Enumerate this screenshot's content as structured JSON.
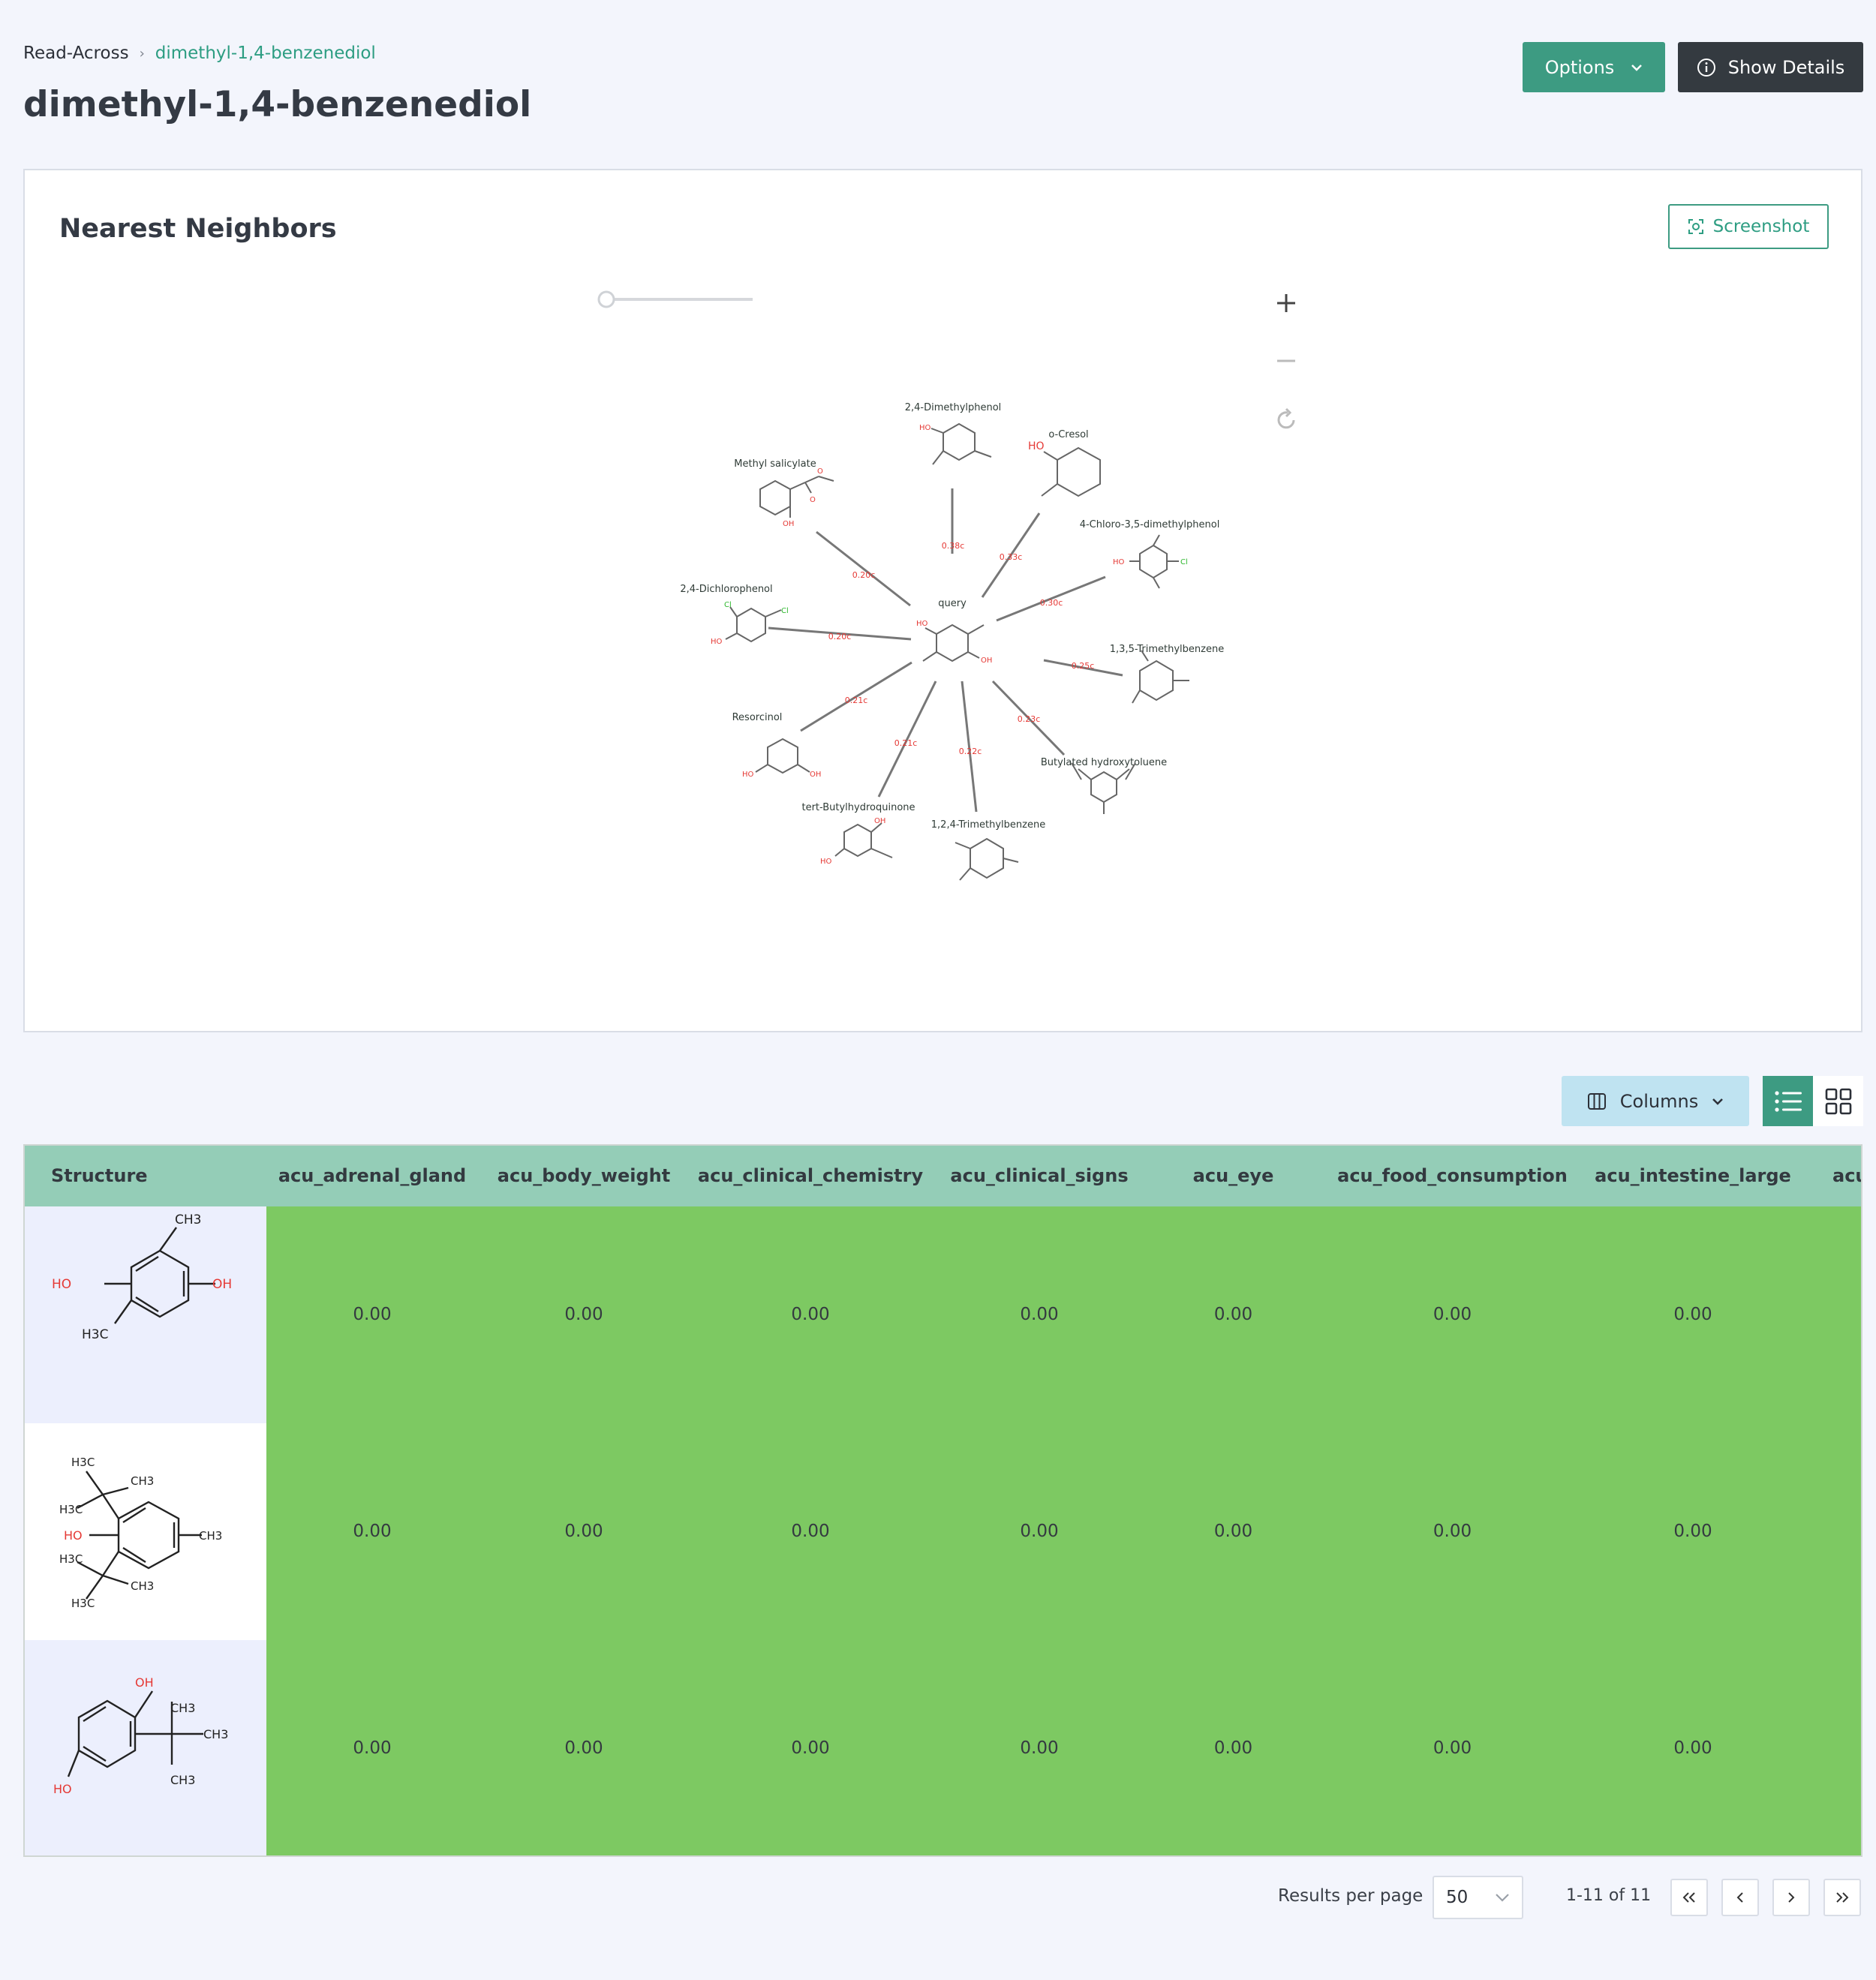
{
  "breadcrumb": {
    "root": "Read-Across",
    "current": "dimethyl-1,4-benzenediol"
  },
  "page": {
    "title": "dimethyl-1,4-benzenediol"
  },
  "header": {
    "options_label": "Options",
    "details_label": "Show Details"
  },
  "nearest_neighbors": {
    "title": "Nearest Neighbors",
    "screenshot_label": "Screenshot",
    "controls": [
      "zoom-in-icon",
      "zoom-out-icon",
      "reset-icon"
    ],
    "query_label": "query",
    "neighbors": [
      {
        "name": "2,4-Dimethylphenol",
        "distance": "0.38c"
      },
      {
        "name": "o-Cresol",
        "distance": "0.33c"
      },
      {
        "name": "4-Chloro-3,5-dimethylphenol",
        "distance": "0.30c"
      },
      {
        "name": "1,3,5-Trimethylbenzene",
        "distance": "0.25c"
      },
      {
        "name": "Butylated hydroxytoluene",
        "distance": "0.23c"
      },
      {
        "name": "1,2,4-Trimethylbenzene",
        "distance": "0.22c"
      },
      {
        "name": "tert-Butylhydroquinone",
        "distance": "0.21c"
      },
      {
        "name": "Resorcinol",
        "distance": "0.21c"
      },
      {
        "name": "2,4-Dichlorophenol",
        "distance": "0.20c"
      },
      {
        "name": "Methyl salicylate",
        "distance": "0.20c"
      }
    ],
    "atom_labels": {
      "HO": "HO",
      "OH": "OH",
      "Cl": "Cl",
      "O": "O"
    }
  },
  "table": {
    "columns_label": "Columns",
    "headers": [
      "Structure",
      "acu_adrenal_gland",
      "acu_body_weight",
      "acu_clinical_chemistry",
      "acu_clinical_signs",
      "acu_eye",
      "acu_food_consumption",
      "acu_intestine_large",
      "acu"
    ],
    "rows": [
      {
        "values": [
          "0.00",
          "0.00",
          "0.00",
          "0.00",
          "0.00",
          "0.00",
          "0.00"
        ]
      },
      {
        "values": [
          "0.00",
          "0.00",
          "0.00",
          "0.00",
          "0.00",
          "0.00",
          "0.00"
        ]
      },
      {
        "values": [
          "0.00",
          "0.00",
          "0.00",
          "0.00",
          "0.00",
          "0.00",
          "0.00"
        ]
      }
    ],
    "structure_labels": {
      "r1": {
        "ch3": "CH3",
        "ho": "HO",
        "oh": "OH",
        "h3c": "H3C"
      },
      "r2": {
        "h3c_a": "H3C",
        "ch3_a": "CH3",
        "h3c_b": "H3C",
        "ho": "HO",
        "ch3_c": "CH3",
        "h3c_d": "H3C",
        "ch3_d": "CH3",
        "h3c_e": "H3C"
      },
      "r3": {
        "oh": "OH",
        "ch3_a": "CH3",
        "ch3_b": "CH3",
        "ch3_c": "CH3",
        "ho": "HO"
      }
    }
  },
  "pagination": {
    "results_per_page_label": "Results per page",
    "per_page": "50",
    "range": "1-11 of 11"
  },
  "colors": {
    "accent": "#3d9b82",
    "dark": "#343a40",
    "cell_green": "#7dc962",
    "header_green": "#94cdb7",
    "info_blue": "#bfe3f1"
  }
}
